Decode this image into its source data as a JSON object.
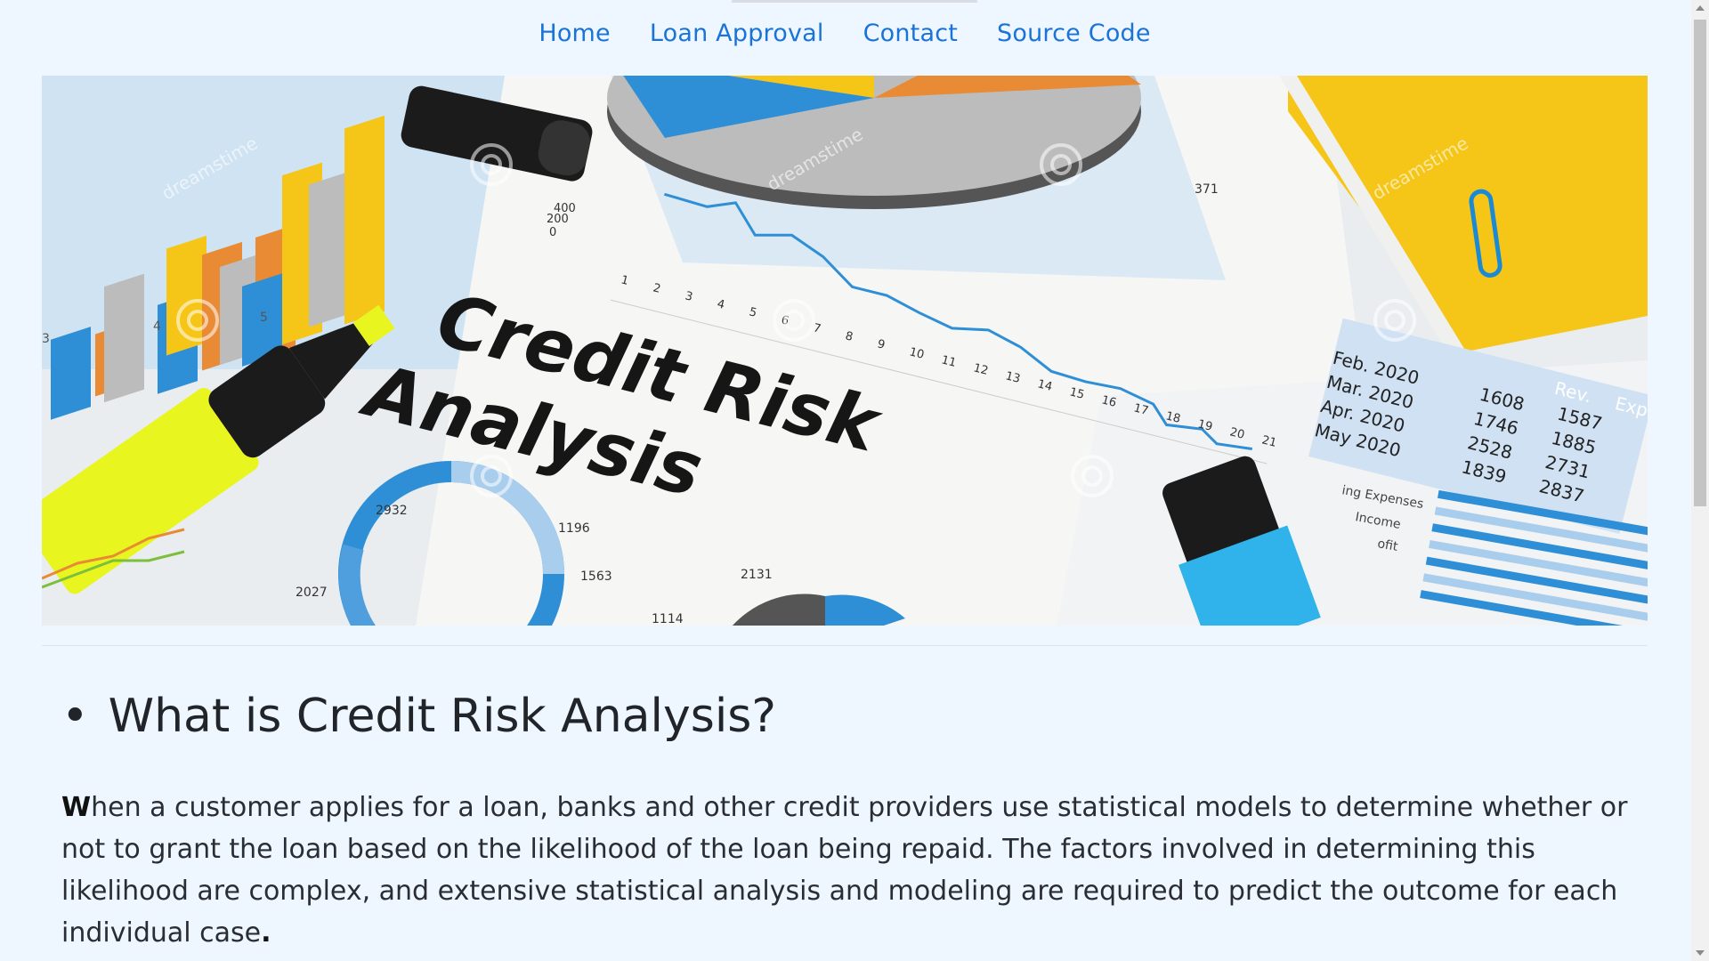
{
  "nav": {
    "items": [
      {
        "label": "Home"
      },
      {
        "label": "Loan Approval"
      },
      {
        "label": "Contact"
      },
      {
        "label": "Source Code"
      }
    ]
  },
  "banner": {
    "title_line1": "Credit Risk",
    "title_line2": "Analysis",
    "watermark": "dreamstime",
    "line_chart_ticks": [
      "1",
      "2",
      "3",
      "4",
      "5",
      "6",
      "7",
      "8",
      "9",
      "10",
      "11",
      "12",
      "13",
      "14",
      "15",
      "16",
      "17",
      "18",
      "19",
      "20",
      "21"
    ],
    "y_ticks": [
      "400",
      "200",
      "0"
    ],
    "pie_label": "371",
    "donut_labels": [
      "2932",
      "1196",
      "1563",
      "2027"
    ],
    "small_pie_labels": [
      "2131",
      "1114"
    ],
    "table": {
      "headers": [
        "Rev.",
        "Exp."
      ],
      "rows": [
        {
          "month": "Feb. 2020",
          "rev": "1608",
          "exp": "1587"
        },
        {
          "month": "Mar. 2020",
          "rev": "1746",
          "exp": "1885"
        },
        {
          "month": "Apr. 2020",
          "rev": "2528",
          "exp": "2731"
        },
        {
          "month": "May 2020",
          "rev": "1839",
          "exp": "2837"
        }
      ]
    },
    "side_list": [
      "ing Expenses",
      "Income",
      "ofit"
    ],
    "colors": {
      "orange": "#e98a35",
      "blue": "#2f8fd6",
      "yellow": "#f5c518",
      "grey": "#bcbcbc",
      "highlighter": "#e9f51e",
      "cyan": "#2fb3ea"
    }
  },
  "section": {
    "bullet": "•",
    "heading": "What is Credit Risk Analysis?",
    "para_first_letter": "W",
    "para_body": "hen a customer applies for a loan, banks and other credit providers use statistical models to determine whether or not to grant the loan based on the likelihood of the loan being repaid. The factors involved in determining this likelihood are complex, and extensive statistical analysis and modeling are required to predict the outcome for each individual case",
    "para_end": "."
  }
}
